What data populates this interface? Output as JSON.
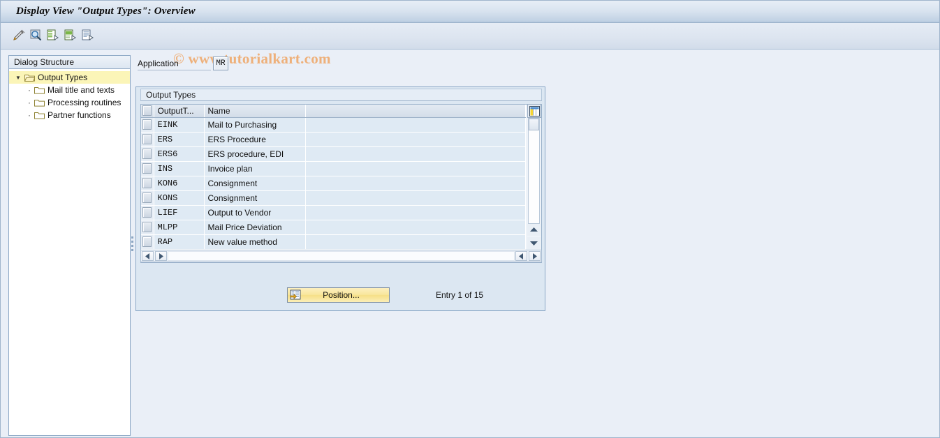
{
  "window": {
    "title": "Display View \"Output Types\": Overview"
  },
  "watermark": "© www.tutorialkart.com",
  "toolbar": {
    "buttons": [
      {
        "name": "change-pencil-icon",
        "tooltip": "Change"
      },
      {
        "name": "display-magnifier-icon",
        "tooltip": "Display"
      },
      {
        "name": "new-entries-icon",
        "tooltip": "New Entries"
      },
      {
        "name": "copy-as-icon",
        "tooltip": "Copy As"
      },
      {
        "name": "details-icon",
        "tooltip": "Details"
      }
    ]
  },
  "sidebar": {
    "header": "Dialog Structure",
    "items": [
      {
        "label": "Output Types",
        "level": 0,
        "selected": true,
        "expanded": true
      },
      {
        "label": "Mail title and texts",
        "level": 1,
        "selected": false
      },
      {
        "label": "Processing routines",
        "level": 1,
        "selected": false
      },
      {
        "label": "Partner functions",
        "level": 1,
        "selected": false
      }
    ]
  },
  "form": {
    "application_label": "Application",
    "application_value": "MR"
  },
  "groupbox": {
    "title": "Output Types"
  },
  "table": {
    "columns": [
      "OutputT...",
      "Name"
    ],
    "rows": [
      {
        "code": "EINK",
        "name": "Mail to Purchasing"
      },
      {
        "code": "ERS",
        "name": "ERS Procedure"
      },
      {
        "code": "ERS6",
        "name": "ERS procedure, EDI"
      },
      {
        "code": "INS",
        "name": "Invoice plan"
      },
      {
        "code": "KON6",
        "name": "Consignment"
      },
      {
        "code": "KONS",
        "name": "Consignment"
      },
      {
        "code": "LIEF",
        "name": "Output to Vendor"
      },
      {
        "code": "MLPP",
        "name": "Mail Price Deviation"
      },
      {
        "code": "RAP",
        "name": "New value method"
      }
    ]
  },
  "footer": {
    "position_button": "Position...",
    "entry_status": "Entry 1 of 15"
  },
  "colors": {
    "title_bar_start": "#e8eef6",
    "title_bar_end": "#a9bed6",
    "page_background": "#eaeff7",
    "groupbox_fill": "#dce7f2",
    "row_fill": "#dfeaf4",
    "tree_selected": "#fbf5b8",
    "button_yellow": "#f8e69c",
    "watermark": "#eeb07a",
    "border": "#8aa7c6"
  }
}
